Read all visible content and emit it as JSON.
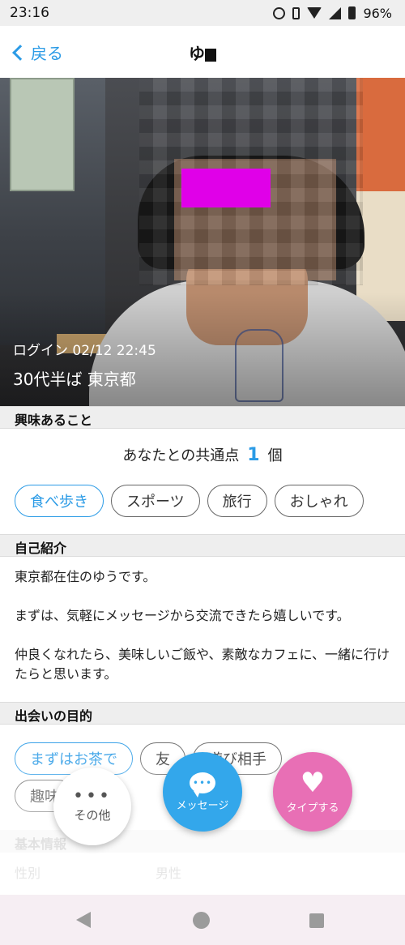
{
  "status_bar": {
    "time": "23:16",
    "battery": "96%"
  },
  "nav": {
    "back_label": "戻る",
    "title": "ゆう"
  },
  "profile": {
    "login": "ログイン 02/12 22:45",
    "age_area": "30代半ば 東京都"
  },
  "interests": {
    "heading": "興味あること",
    "common_prefix": "あなたとの共通点",
    "common_count": "1",
    "common_suffix": "個",
    "tags": [
      {
        "label": "食べ歩き",
        "active": true
      },
      {
        "label": "スポーツ",
        "active": false
      },
      {
        "label": "旅行",
        "active": false
      },
      {
        "label": "おしゃれ",
        "active": false
      }
    ]
  },
  "intro": {
    "heading": "自己紹介",
    "paragraphs": [
      "東京都在住のゆうです。",
      "まずは、気軽にメッセージから交流できたら嬉しいです。",
      "仲良くなれたら、美味しいご飯や、素敵なカフェに、一緒に行けたらと思います。"
    ]
  },
  "purpose": {
    "heading": "出会いの目的",
    "tags": [
      {
        "label": "まずはお茶で",
        "active": true
      },
      {
        "label": "友",
        "active": false
      },
      {
        "label": "遊び相手",
        "active": false
      },
      {
        "label": "趣味",
        "active": false
      }
    ]
  },
  "basic": {
    "heading": "基本情報",
    "gender_key": "性別",
    "gender_value": "男性"
  },
  "actions": {
    "other": "その他",
    "message": "メッセージ",
    "like": "タイプする"
  }
}
